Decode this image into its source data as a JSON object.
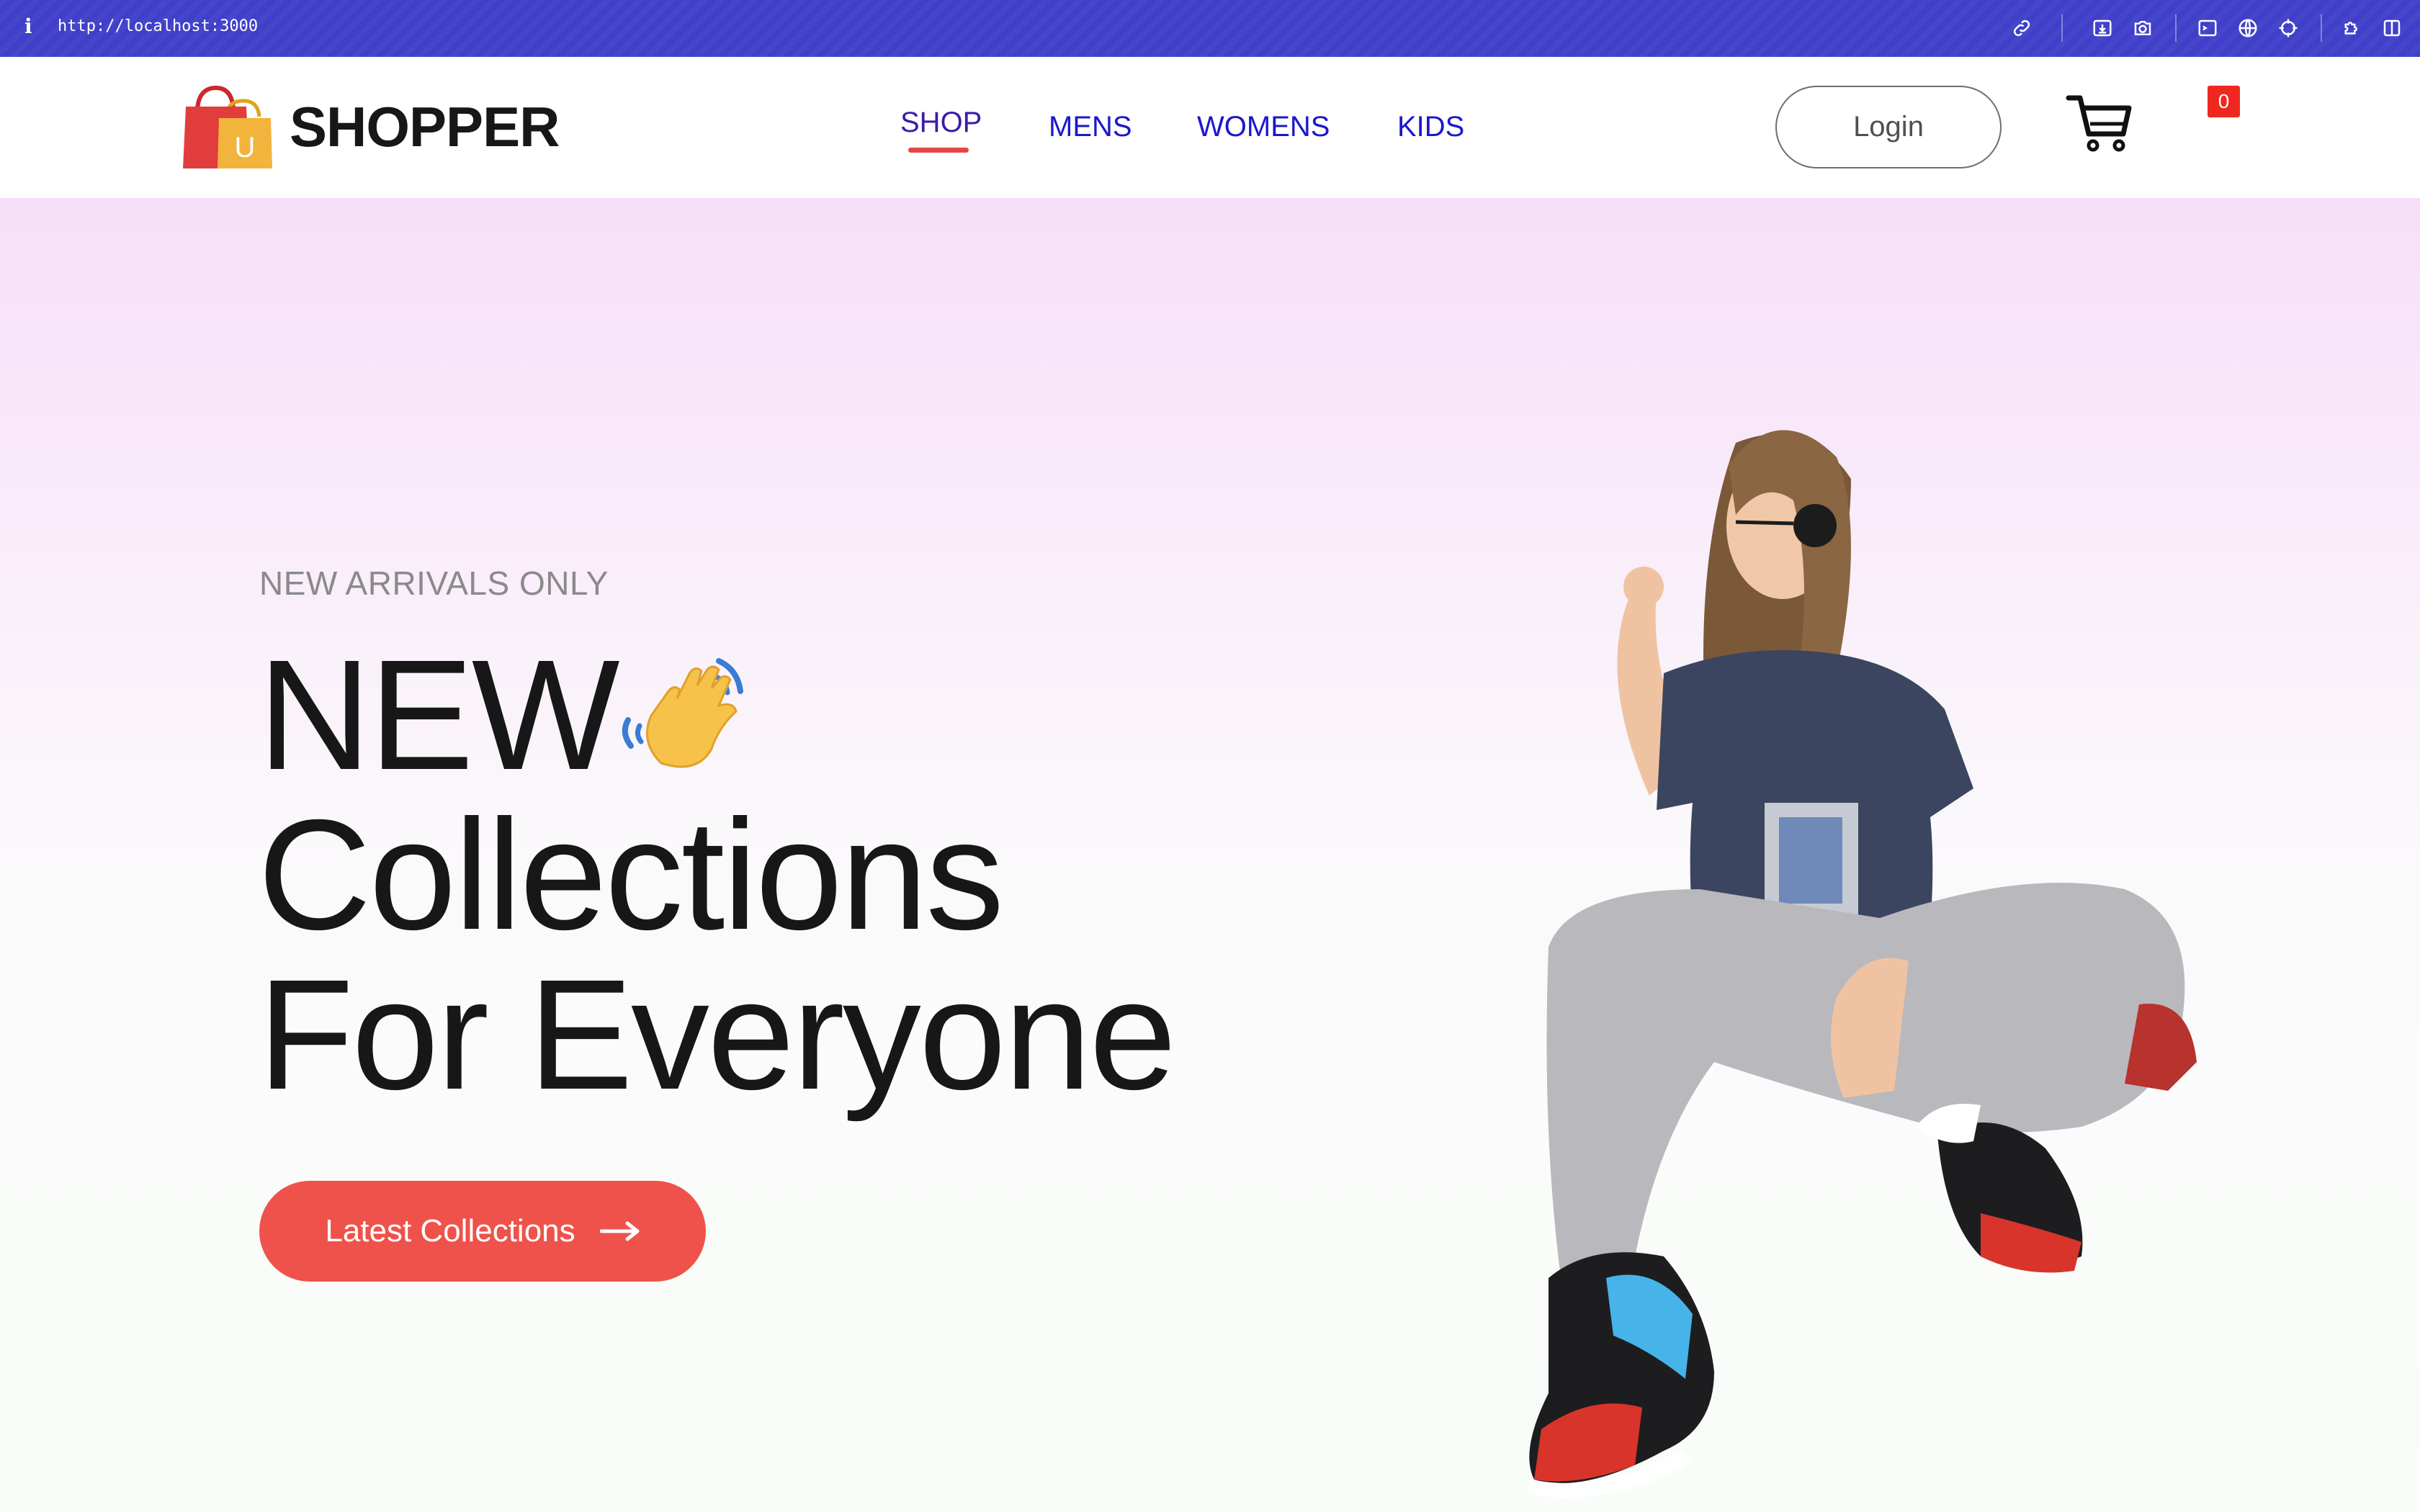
{
  "browser": {
    "url": "http://localhost:3000",
    "icons": [
      "info-icon",
      "link-icon",
      "download-icon",
      "camera-icon",
      "terminal-icon",
      "globe-icon",
      "crosshair-icon",
      "extensions-icon",
      "sidebar-icon"
    ]
  },
  "navbar": {
    "logo_text": "SHOPPER",
    "logo_bag_letter": "U",
    "menu": [
      {
        "label": "SHOP",
        "active": true
      },
      {
        "label": "MENS",
        "active": false
      },
      {
        "label": "WOMENS",
        "active": false
      },
      {
        "label": "KIDS",
        "active": false
      }
    ],
    "login_label": "Login",
    "cart_count": "0"
  },
  "hero": {
    "subtitle": "NEW ARRIVALS ONLY",
    "title_lines": [
      "NEW",
      "Collections",
      "For Everyone"
    ],
    "cta_label": "Latest Collections",
    "image_alt": "woman-crouching-in-streetwear"
  },
  "colors": {
    "topbar": "#3f3fc9",
    "nav_link": "#1a18cc",
    "accent": "#ef524a",
    "badge": "#f0271f",
    "hero_top": "#f7def8",
    "hero_bottom": "#f8fdf8"
  }
}
